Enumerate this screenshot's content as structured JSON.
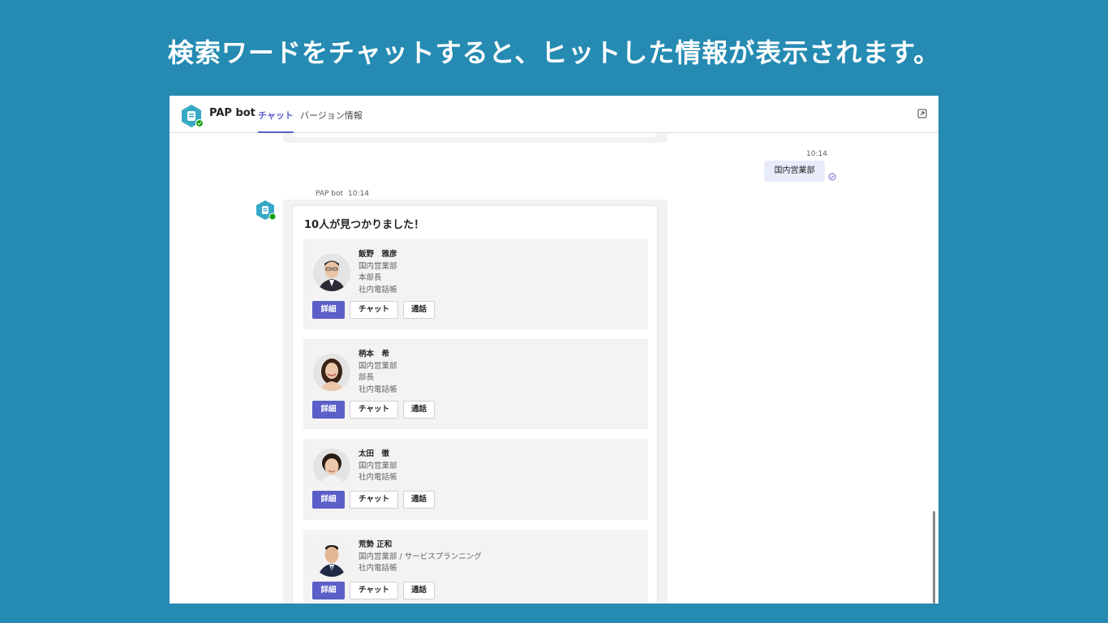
{
  "headline": "検索ワードをチャットすると、ヒットした情報が表示されます。",
  "app": {
    "title": "PAP bot",
    "tabs": [
      "チャット",
      "バージョン情報"
    ]
  },
  "sent_message": {
    "time": "10:14",
    "text": "国内営業部"
  },
  "bot_message": {
    "sender": "PAP bot",
    "time": "10:14",
    "card_title": "10人が見つかりました！",
    "people": [
      {
        "name": "飯野　雅彦",
        "lines": [
          "国内営業部",
          "本部長",
          "社内電話帳"
        ],
        "buttons": [
          "詳細",
          "チャット",
          "通話"
        ]
      },
      {
        "name": "柄本　希",
        "lines": [
          "国内営業部",
          "部長",
          "社内電話帳"
        ],
        "buttons": [
          "詳細",
          "チャット",
          "通話"
        ]
      },
      {
        "name": "太田　徹",
        "lines": [
          "国内営業部",
          "社内電話帳"
        ],
        "buttons": [
          "詳細",
          "チャット",
          "通話"
        ]
      },
      {
        "name": "荒勢 正和",
        "lines": [
          "国内営業部 / サービスプランニング",
          "社内電話帳"
        ],
        "buttons": [
          "詳細",
          "チャット",
          "通話"
        ]
      }
    ]
  },
  "colors": {
    "background": "#258bb2",
    "accent": "#5b5fc7",
    "bot_logo": "#36a9c6",
    "status_green": "#13a10e"
  },
  "icons": [
    "bot-logo-icon",
    "popout-icon",
    "read-receipt-icon",
    "online-status-icon"
  ]
}
